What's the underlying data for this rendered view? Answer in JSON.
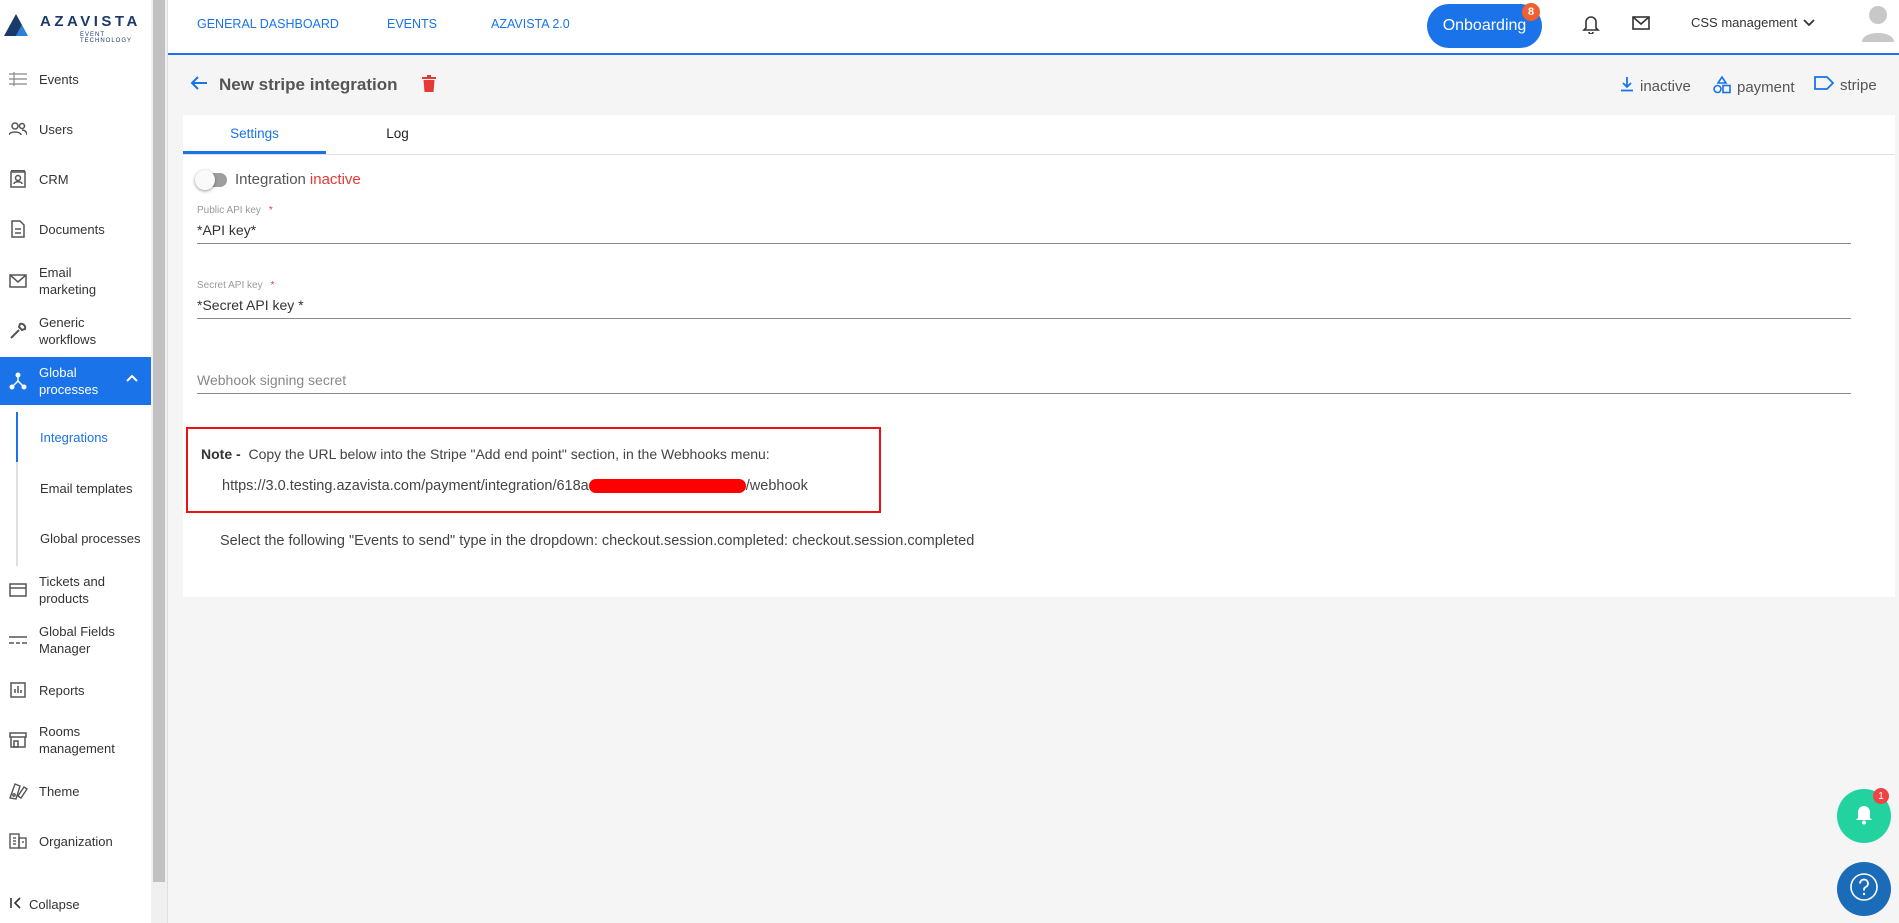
{
  "brand": {
    "name": "AZAVISTA",
    "tagline": "EVENT TECHNOLOGY"
  },
  "sidebar": {
    "items": [
      {
        "label": "Events",
        "icon": "list-icon"
      },
      {
        "label": "Users",
        "icon": "users-icon"
      },
      {
        "label": "CRM",
        "icon": "contact-card-icon"
      },
      {
        "label": "Documents",
        "icon": "document-icon"
      },
      {
        "label": "Email marketing",
        "icon": "mail-icon"
      },
      {
        "label": "Generic workflows",
        "icon": "wrench-icon"
      },
      {
        "label": "Global processes",
        "icon": "network-icon",
        "expanded": true
      },
      {
        "label": "Tickets and products",
        "icon": "card-icon"
      },
      {
        "label": "Global Fields Manager",
        "icon": "fields-icon"
      },
      {
        "label": "Reports",
        "icon": "chart-icon"
      },
      {
        "label": "Rooms management",
        "icon": "store-icon"
      },
      {
        "label": "Theme",
        "icon": "palette-icon"
      },
      {
        "label": "Organization",
        "icon": "building-icon"
      }
    ],
    "subitems": [
      {
        "label": "Integrations",
        "active": true
      },
      {
        "label": "Email templates"
      },
      {
        "label": "Global processes"
      }
    ],
    "collapse_label": "Collapse"
  },
  "topbar": {
    "links": [
      "GENERAL DASHBOARD",
      "EVENTS",
      "AZAVISTA 2.0"
    ],
    "onboarding_label": "Onboarding",
    "onboarding_count": "8",
    "account_label": "CSS management"
  },
  "page": {
    "title": "New stripe integration",
    "tags": [
      {
        "label": "inactive",
        "icon": "download-icon"
      },
      {
        "label": "payment",
        "icon": "shapes-icon"
      },
      {
        "label": "stripe",
        "icon": "label-icon"
      }
    ]
  },
  "tabs": [
    {
      "label": "Settings",
      "active": true
    },
    {
      "label": "Log"
    }
  ],
  "form": {
    "toggle_label": "Integration",
    "toggle_status": "inactive",
    "public_key": {
      "label": "Public API key",
      "required": "*",
      "value": "*API key*"
    },
    "secret_key": {
      "label": "Secret API key",
      "required": "*",
      "value": "*Secret API key *"
    },
    "webhook_secret": {
      "placeholder": "Webhook signing secret"
    }
  },
  "note": {
    "prefix": "Note -",
    "text": "Copy the URL below into the Stripe \"Add end point\" section, in the Webhooks menu:",
    "url_start": "https://3.0.testing.azavista.com/payment/integration/618a",
    "url_end": "/webhook"
  },
  "events_text": "Select the following \"Events to send\" type in the dropdown: checkout.session.completed: checkout.session.completed",
  "floating": {
    "notification_count": "1"
  },
  "colors": {
    "primary": "#1a73e8",
    "danger": "#e53935",
    "fab_green": "#22d3a0",
    "fab_blue": "#1a6bb8"
  }
}
